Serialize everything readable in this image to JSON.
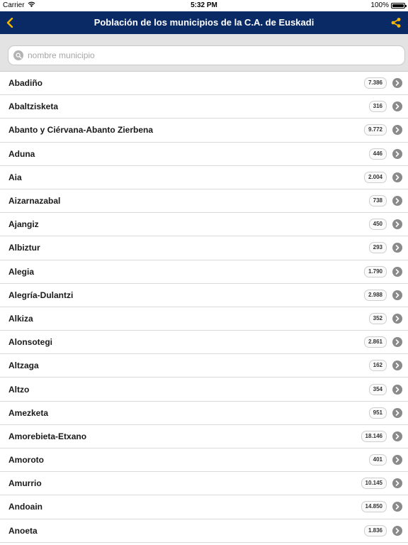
{
  "status_bar": {
    "carrier": "Carrier",
    "time": "5:32 PM",
    "battery_text": "100%",
    "battery_level": 1.0,
    "icons": [
      "wifi-icon",
      "battery-icon"
    ]
  },
  "nav": {
    "title": "Población de los municipios de la C.A. de Euskadi",
    "back_icon": "chevron-left-icon",
    "share_icon": "share-icon",
    "accent_color": "#f5b800",
    "background_color": "#0a2a66"
  },
  "search": {
    "placeholder": "nombre municipio",
    "value": "",
    "icon": "search-icon"
  },
  "municipios": [
    {
      "name": "Abadiño",
      "population": "7.386"
    },
    {
      "name": "Abaltzisketa",
      "population": "316"
    },
    {
      "name": "Abanto y Ciérvana-Abanto Zierbena",
      "population": "9.772"
    },
    {
      "name": "Aduna",
      "population": "446"
    },
    {
      "name": "Aia",
      "population": "2.004"
    },
    {
      "name": "Aizarnazabal",
      "population": "738"
    },
    {
      "name": "Ajangiz",
      "population": "450"
    },
    {
      "name": "Albiztur",
      "population": "293"
    },
    {
      "name": "Alegia",
      "population": "1.790"
    },
    {
      "name": "Alegría-Dulantzi",
      "population": "2.988"
    },
    {
      "name": "Alkiza",
      "population": "352"
    },
    {
      "name": "Alonsotegi",
      "population": "2.861"
    },
    {
      "name": "Altzaga",
      "population": "162"
    },
    {
      "name": "Altzo",
      "population": "354"
    },
    {
      "name": "Amezketa",
      "population": "951"
    },
    {
      "name": "Amorebieta-Etxano",
      "population": "18.146"
    },
    {
      "name": "Amoroto",
      "population": "401"
    },
    {
      "name": "Amurrio",
      "population": "10.145"
    },
    {
      "name": "Andoain",
      "population": "14.850"
    },
    {
      "name": "Anoeta",
      "population": "1.836"
    }
  ]
}
